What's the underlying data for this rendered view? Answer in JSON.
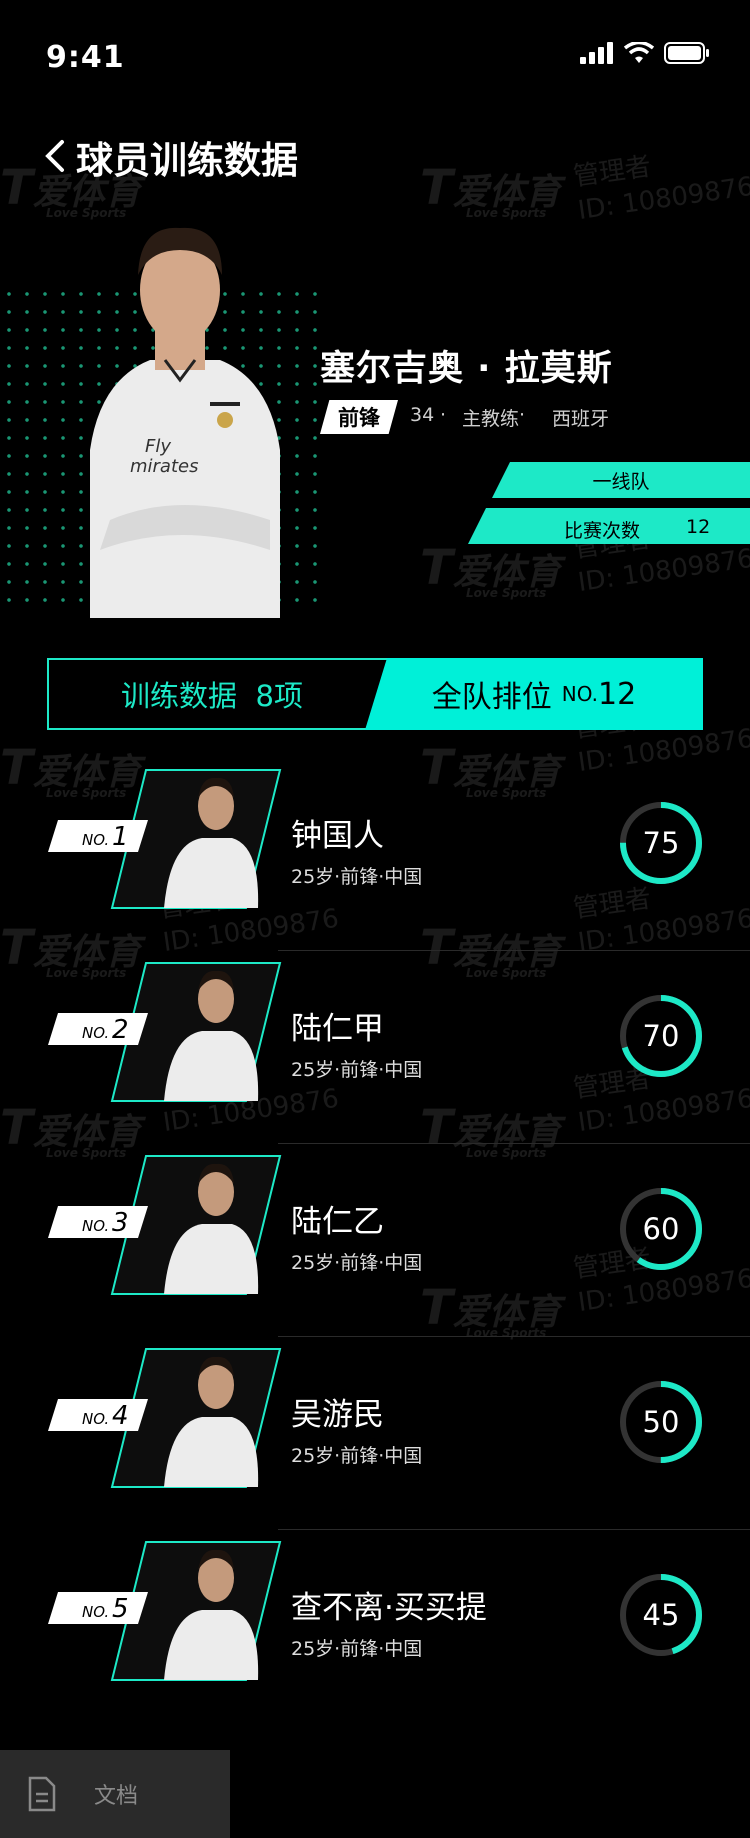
{
  "status": {
    "time": "9:41"
  },
  "header": {
    "title": "球员训练数据"
  },
  "watermark": {
    "brand": "爱体育",
    "sub": "Love Sports",
    "role": "管理者",
    "id": "ID: 10809876"
  },
  "player": {
    "name": "塞尔吉奥 · 拉莫斯",
    "position": "前锋",
    "number": "34",
    "role": "主教练",
    "country": "西班牙",
    "team": "一线队",
    "matches_label": "比赛次数",
    "matches": "12"
  },
  "summary": {
    "training_label": "训练数据",
    "training_count": "8项",
    "rank_label": "全队排位",
    "rank_prefix": "NO.",
    "rank_value": "12"
  },
  "ranking": [
    {
      "rank": "1",
      "name": "钟国人",
      "info": "25岁·前锋·中国",
      "score": "75",
      "percent": 75
    },
    {
      "rank": "2",
      "name": "陆仁甲",
      "info": "25岁·前锋·中国",
      "score": "70",
      "percent": 70
    },
    {
      "rank": "3",
      "name": "陆仁乙",
      "info": "25岁·前锋·中国",
      "score": "60",
      "percent": 60
    },
    {
      "rank": "4",
      "name": "吴游民",
      "info": "25岁·前锋·中国",
      "score": "50",
      "percent": 50
    },
    {
      "rank": "5",
      "name": "查不离·买买提",
      "info": "25岁·前锋·中国",
      "score": "45",
      "percent": 45
    }
  ],
  "rank_no_prefix": "NO.",
  "bottom": {
    "doc_label": "文档"
  },
  "colors": {
    "accent": "#1de9c7",
    "tab": "#00f0d8",
    "ring_track": "#333333"
  }
}
